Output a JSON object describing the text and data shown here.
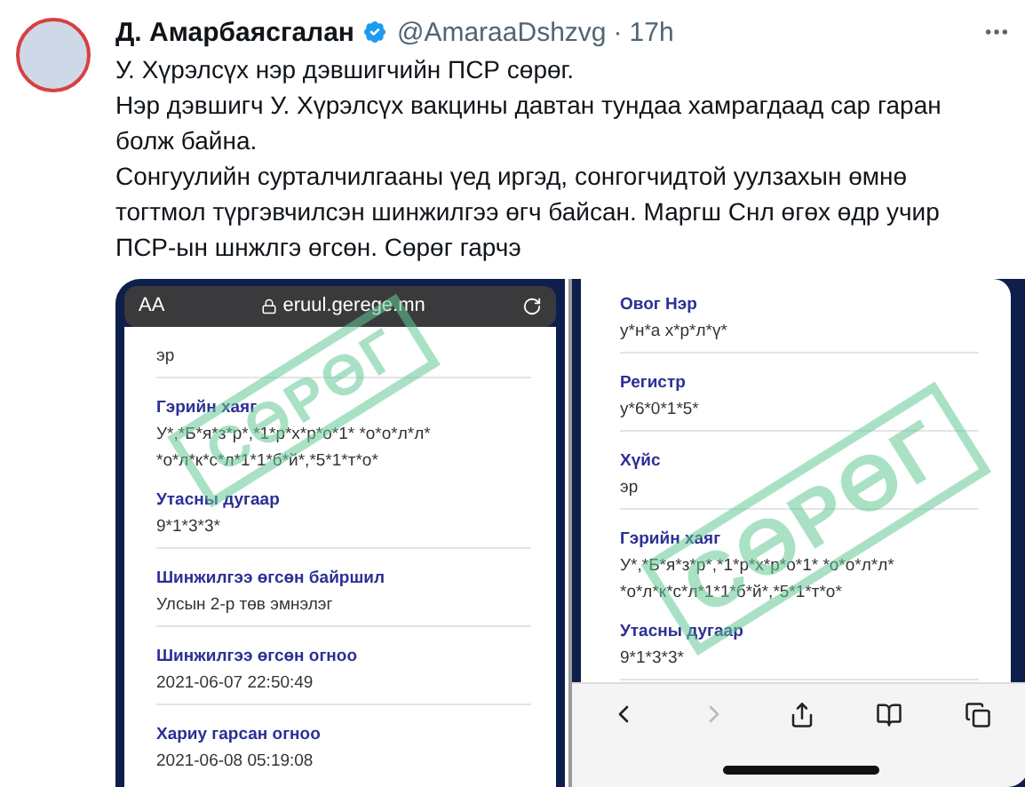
{
  "tweet": {
    "author": "Д. Амарбаясгалан",
    "verified": true,
    "handle": "@AmaraaDshzvg",
    "separator": "·",
    "time": "17h",
    "paragraphs": [
      "У. Хүрэлсүх нэр дэвшигчийн ПСР сөрөг.",
      "Нэр дэвшигч У. Хүрэлсүх вакцины давтан тундаа хамрагдаад сар гаран болж байна.",
      "Сонгуулийн сурталчилгааны үед иргэд, сонгогчидтой уулзахын өмнө тогтмол түргэвчилсэн шинжилгээ өгч байсан. Маргш Снл өгөх өдр учир ПСР-ын шнжлгэ өгсөн. Сөрөг гарчэ"
    ]
  },
  "images": [
    {
      "kind": "address_bar",
      "text_size": "AA",
      "url": "eruul.gerege.mn",
      "stamp": "СӨРӨГ",
      "fields": [
        {
          "values": [
            "эр"
          ],
          "divider_after": true
        },
        {
          "label": "Гэрийн хаяг",
          "values": [
            "У*,*Б*я*з*р*,*1*р*х*р*о*1* *о*о*л*л*",
            "*о*л*к*с*л*1*1*б*й*,*5*1*т*о*"
          ],
          "divider_after": false
        },
        {
          "label": "Утасны дугаар",
          "values": [
            "9*1*3*3*"
          ],
          "divider_after": true
        },
        {
          "label": "Шинжилгээ өгсөн байршил",
          "values": [
            "Улсын 2-р төв эмнэлэг"
          ],
          "divider_after": true
        },
        {
          "label": "Шинжилгээ өгсөн огноо",
          "values": [
            "2021-06-07 22:50:49"
          ],
          "divider_after": true
        },
        {
          "label": "Хариу гарсан огноо",
          "values": [
            "2021-06-08 05:19:08"
          ],
          "divider_after": false
        }
      ]
    },
    {
      "kind": "toolbar",
      "stamp": "СӨРӨГ",
      "fields": [
        {
          "label": "Овог Нэр",
          "values": [
            "у*н*а х*р*л*ү*"
          ],
          "divider_after": true
        },
        {
          "label": "Регистр",
          "values": [
            "у*6*0*1*5*"
          ],
          "divider_after": true
        },
        {
          "label": "Хүйс",
          "values": [
            "эр"
          ],
          "divider_after": true
        },
        {
          "label": "Гэрийн хаяг",
          "values": [
            "У*,*Б*я*з*р*,*1*р*х*р*о*1* *о*о*л*л*",
            "*о*л*к*с*л*1*1*б*й*,*5*1*т*о*"
          ],
          "divider_after": false
        },
        {
          "label": "Утасны дугаар",
          "values": [
            "9*1*3*3*"
          ],
          "divider_after": true
        }
      ]
    }
  ]
}
